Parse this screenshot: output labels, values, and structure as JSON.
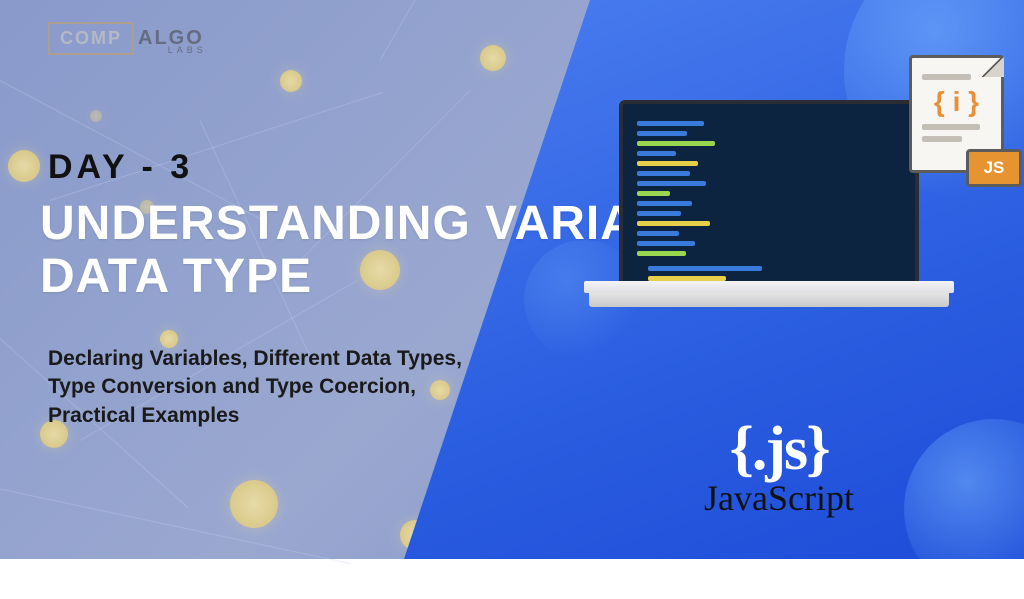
{
  "logo": {
    "comp": "COMP",
    "algo": "ALGO",
    "labs": "LABS"
  },
  "day": "DAY - 3",
  "title_line1": "UNDERSTANDING VARIABLE &",
  "title_line2": "DATA TYPE",
  "subtitle": "Declaring Variables, Different Data Types, Type Conversion and Type Coercion, Practical Examples",
  "file": {
    "braces": "{ i }",
    "badge": "JS"
  },
  "js": {
    "curly": "{.js}",
    "name": "JavaScript"
  }
}
